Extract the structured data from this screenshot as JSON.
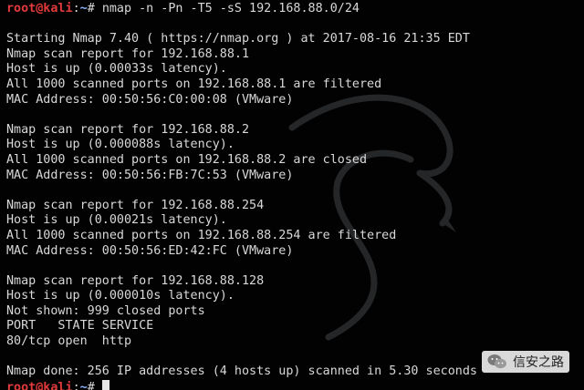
{
  "prompt": {
    "user": "root@kali",
    "sep": ":",
    "path": "~",
    "sym": "# "
  },
  "command": "nmap -n -Pn -T5 -sS 192.168.88.0/24",
  "output": [
    "",
    "Starting Nmap 7.40 ( https://nmap.org ) at 2017-08-16 21:35 EDT",
    "Nmap scan report for 192.168.88.1",
    "Host is up (0.00033s latency).",
    "All 1000 scanned ports on 192.168.88.1 are filtered",
    "MAC Address: 00:50:56:C0:00:08 (VMware)",
    "",
    "Nmap scan report for 192.168.88.2",
    "Host is up (0.000088s latency).",
    "All 1000 scanned ports on 192.168.88.2 are closed",
    "MAC Address: 00:50:56:FB:7C:53 (VMware)",
    "",
    "Nmap scan report for 192.168.88.254",
    "Host is up (0.00021s latency).",
    "All 1000 scanned ports on 192.168.88.254 are filtered",
    "MAC Address: 00:50:56:ED:42:FC (VMware)",
    "",
    "Nmap scan report for 192.168.88.128",
    "Host is up (0.000010s latency).",
    "Not shown: 999 closed ports",
    "PORT   STATE SERVICE",
    "80/tcp open  http",
    "",
    "Nmap done: 256 IP addresses (4 hosts up) scanned in 5.30 seconds"
  ],
  "watermark": {
    "text": "信安之路",
    "icon": "wechat-icon"
  },
  "colors": {
    "background": "#020202",
    "text": "#d8d8d8",
    "prompt_user": "#e23a3a",
    "prompt_path": "#8ab4ff"
  }
}
